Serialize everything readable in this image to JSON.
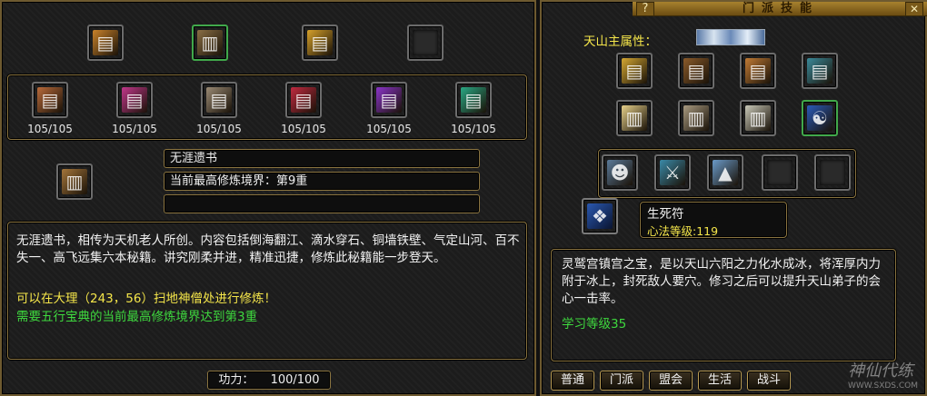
{
  "left": {
    "top_icons": [
      {
        "name": "scroll-gold-icon",
        "color": "#c9822a",
        "glyph": "▤"
      },
      {
        "name": "scroll-green-icon",
        "color": "#8a6e44",
        "glyph": "▥"
      },
      {
        "name": "scroll-yellow-icon",
        "color": "#d6a12a",
        "glyph": "▤"
      },
      {
        "name": "empty-slot-icon",
        "color": "#2a2a2a",
        "glyph": ""
      }
    ],
    "books": [
      {
        "count": "105/105",
        "color": "#b86a3a"
      },
      {
        "count": "105/105",
        "color": "#c0378a"
      },
      {
        "count": "105/105",
        "color": "#9a8a74"
      },
      {
        "count": "105/105",
        "color": "#c02a40"
      },
      {
        "count": "105/105",
        "color": "#8a34c8"
      },
      {
        "count": "105/105",
        "color": "#2aa884"
      }
    ],
    "selected_color": "#a4753a",
    "book_name": "无涯遗书",
    "realm_label": "当前最高修炼境界：第9重",
    "empty_field": "",
    "desc_white": "无涯遗书，相传为天机老人所创。内容包括倒海翻江、滴水穿石、铜墙铁壁、气定山河、百不失一、高飞远集六本秘籍。讲究刚柔并进，精准迅捷，修炼此秘籍能一步登天。",
    "desc_yellow": "可以在大理（243，56）扫地神僧处进行修炼！",
    "desc_green": "需要五行宝典的当前最高修炼境界达到第3重",
    "power_label": "功力：",
    "power_value": "100/100"
  },
  "right": {
    "help_glyph": "?",
    "title": "门派技能",
    "close_glyph": "✕",
    "attr_label": "天山主属性：",
    "skill_icons_row1": [
      {
        "name": "yellow-book-icon",
        "color": "#d4a732"
      },
      {
        "name": "brown-book-icon",
        "color": "#8a5a2a"
      },
      {
        "name": "orange-book-icon",
        "color": "#c07a34"
      },
      {
        "name": "teal-book-icon",
        "color": "#3a8a9a"
      }
    ],
    "skill_icons_row2": [
      {
        "name": "open-book-icon",
        "color": "#e6d08a"
      },
      {
        "name": "grey-book-icon",
        "color": "#a89a80"
      },
      {
        "name": "silver-book-icon",
        "color": "#c8c8b8"
      },
      {
        "name": "blue-book-icon",
        "color": "#2a5ab8"
      }
    ],
    "portraits": [
      {
        "name": "old-master-portrait-icon",
        "color": "#5a7a9a"
      },
      {
        "name": "ice-figures-icon",
        "color": "#3a8aa8"
      },
      {
        "name": "ice-mountain-icon",
        "color": "#6a9ac8"
      },
      {
        "name": "empty-slot-icon",
        "color": "#2a2a2a"
      },
      {
        "name": "empty-slot-icon",
        "color": "#2a2a2a"
      }
    ],
    "skill_icon_color": "#2a58b0",
    "skill_name": "生死符",
    "skill_level": "心法等级:119",
    "skill_desc": "灵鹫宫镇宫之宝，是以天山六阳之力化水成冰，将浑厚内力附于冰上，封死敌人要穴。修习之后可以提升天山弟子的会心一击率。",
    "learn_level": "学习等级35",
    "tabs": [
      "普通",
      "门派",
      "盟会",
      "生活",
      "战斗"
    ],
    "watermark": "神仙代练",
    "watermark_url": "WWW.SXDS.COM"
  }
}
